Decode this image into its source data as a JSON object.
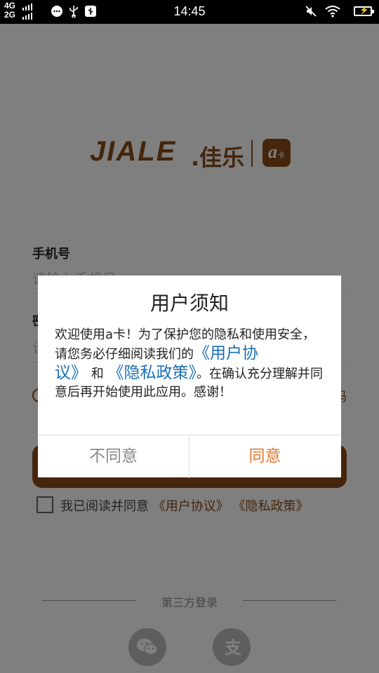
{
  "status_bar": {
    "network_top": "4G",
    "network_bottom": "2G",
    "time": "14:45"
  },
  "brand": {
    "logo_latin": "JIALE",
    "logo_chinese": ".佳乐",
    "badge_letter": "a",
    "badge_sub": "卡",
    "color": "#8a4b16"
  },
  "form": {
    "phone_label": "手机号",
    "phone_placeholder": "请输入手机号",
    "second_label_fragment": "密",
    "second_placeholder_fragment": "请",
    "code_fragment": "码"
  },
  "agreement": {
    "prefix": "我已阅读并同意",
    "user_agreement": "《用户协议》",
    "privacy_policy": "《隐私政策》"
  },
  "third_party": {
    "label": "第三方登录"
  },
  "dialog": {
    "title": "用户须知",
    "body_part1": "欢迎使用a卡！为了保护您的隐私和使用安全，请您务必仔细阅读我们的",
    "link_user_agreement": "《用户协议》",
    "body_and": "和",
    "link_privacy": "《隐私政策》",
    "body_part2": "。在确认充分理解并同意后再开始使用此应用。感谢！",
    "disagree": "不同意",
    "agree": "同意",
    "disagree_color": "#888888",
    "agree_color": "#e07a2c",
    "link_color": "#1a6fb5"
  }
}
